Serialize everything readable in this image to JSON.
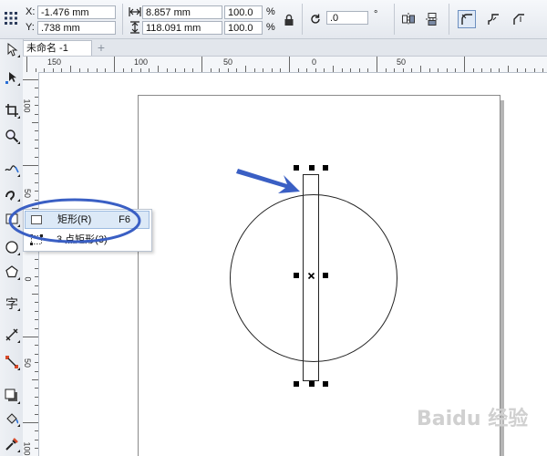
{
  "propbar": {
    "x_label": "X:",
    "x_value": "-1.476 mm",
    "y_label": "Y:",
    "y_value": ".738 mm",
    "width_value": "8.857 mm",
    "height_value": "118.091 mm",
    "scale_w": "100.0",
    "scale_h": "100.0",
    "percent": "%",
    "rotation_value": ".0",
    "degree": "°"
  },
  "document": {
    "tab_title": "未命名 -1",
    "add_tab": "+"
  },
  "rulers": {
    "horizontal": [
      "150",
      "100",
      "50",
      "0",
      "50"
    ],
    "vertical": [
      "100",
      "50",
      "0",
      "50",
      "100"
    ]
  },
  "flyout": {
    "items": [
      {
        "label": "矩形(R)",
        "shortcut": "F6"
      },
      {
        "label": "3 点矩形(3)",
        "shortcut": ""
      }
    ]
  },
  "colors": {
    "annotation_blue": "#3a5fc4",
    "selection_handle": "#000000"
  }
}
